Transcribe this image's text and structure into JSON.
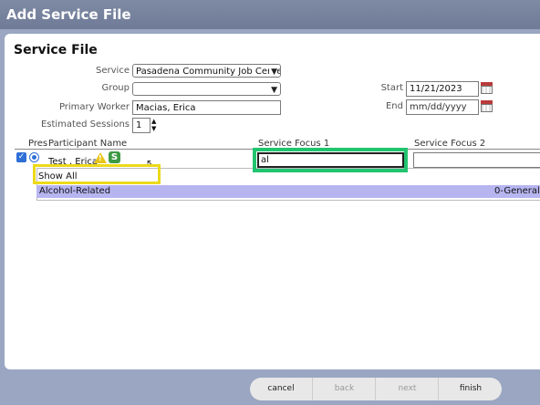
{
  "window": {
    "title": "Add Service File"
  },
  "form": {
    "heading": "Service File",
    "service_label": "Service",
    "service_value": "Pasadena Community Job Center",
    "group_label": "Group",
    "group_value": "",
    "primary_worker_label": "Primary Worker",
    "primary_worker_value": "Macias, Erica",
    "estimated_sessions_label": "Estimated Sessions",
    "estimated_sessions_value": "1",
    "start_label": "Start",
    "start_value": "11/21/2023",
    "end_label": "End",
    "end_placeholder": "mm/dd/yyyy"
  },
  "table": {
    "col_pres": "Pres",
    "col_participant": "Participant Name",
    "col_focus1": "Service Focus 1",
    "col_focus2": "Service Focus 2",
    "row_participant": "Test , Erica",
    "row_focus1_value": "al",
    "row_focus2_value": "",
    "badge_s": "S"
  },
  "dropdown": {
    "show_all": "Show All",
    "option_label": "Alcohol-Related",
    "option_code": "0-General"
  },
  "buttons": {
    "cancel": "cancel",
    "back": "back",
    "next": "next",
    "finish": "finish"
  },
  "colors": {
    "highlight_yellow": "#ecd91a",
    "highlight_green": "#21c46f",
    "option_bg": "#b7b5f0"
  },
  "icons": [
    "calendar-icon",
    "warning-icon",
    "checkbox-icon",
    "radio-icon",
    "chevron-down-icon",
    "mouse-cursor-icon"
  ]
}
